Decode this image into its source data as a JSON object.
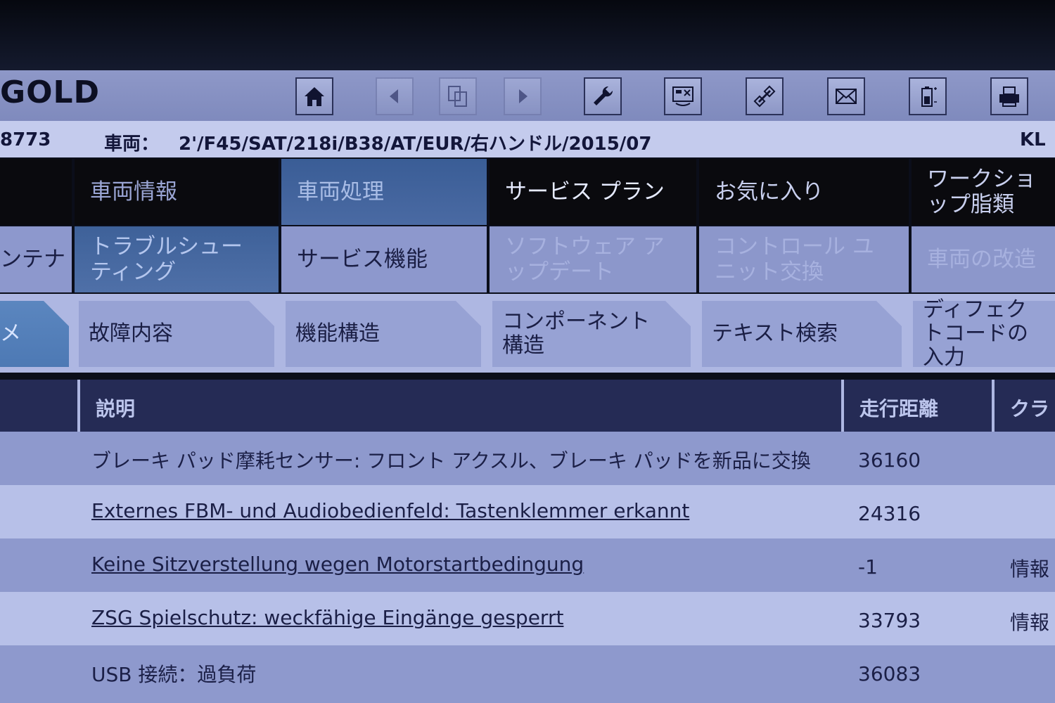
{
  "app_title": "GOLD",
  "toolbar": {
    "buttons": [
      {
        "icon": "home-icon",
        "enabled": true
      },
      {
        "icon": "arrow-left-icon",
        "enabled": false
      },
      {
        "icon": "documents-icon",
        "enabled": false
      },
      {
        "icon": "arrow-right-icon",
        "enabled": false
      },
      {
        "icon": "wrench-icon",
        "enabled": true
      },
      {
        "icon": "vehicle-test-icon",
        "enabled": true
      },
      {
        "icon": "connection-icon",
        "enabled": true
      },
      {
        "icon": "mail-icon",
        "enabled": true
      },
      {
        "icon": "battery-icon",
        "enabled": true
      },
      {
        "icon": "printer-icon",
        "enabled": true
      }
    ]
  },
  "vehicle_bar": {
    "order_partial": "8773",
    "vehicle_label": "車両：",
    "vehicle_value": "2'/F45/SAT/218i/B38/AT/EUR/右ハンドル/2015/07",
    "kl_label": "KL"
  },
  "main_tabs": [
    {
      "label": "",
      "state": "inactive"
    },
    {
      "label": "車両情報",
      "state": "inactive"
    },
    {
      "label": "車両処理",
      "state": "active"
    },
    {
      "label": "サービス プラン",
      "state": "inactive"
    },
    {
      "label": "お気に入り",
      "state": "inactive"
    },
    {
      "label": "ワークショップ脂類",
      "state": "inactive"
    }
  ],
  "sub_tabs": [
    {
      "label": "ンテナ",
      "state": "enabled"
    },
    {
      "label": "トラブルシューティング",
      "state": "active"
    },
    {
      "label": "サービス機能",
      "state": "enabled"
    },
    {
      "label": "ソフトウェア アップデート",
      "state": "disabled"
    },
    {
      "label": "コントロール ユニット交換",
      "state": "disabled"
    },
    {
      "label": "車両の改造",
      "state": "disabled"
    }
  ],
  "folder_tabs": [
    {
      "label": "メ",
      "state": "active"
    },
    {
      "label": "故障内容",
      "state": "enabled"
    },
    {
      "label": "機能構造",
      "state": "enabled"
    },
    {
      "label": "コンポーネント構造",
      "state": "enabled"
    },
    {
      "label": "テキスト検索",
      "state": "enabled"
    },
    {
      "label": "ディフェクトコードの入力",
      "state": "enabled"
    }
  ],
  "table": {
    "headers": {
      "description": "説明",
      "mileage": "走行距離",
      "class": "クラ"
    },
    "rows": [
      {
        "description": "ブレーキ パッド摩耗センサー: フロント アクスル、ブレーキ パッドを新品に交換",
        "mileage": "36160",
        "class": "",
        "link": false
      },
      {
        "description": "Externes FBM- und Audiobedienfeld: Tastenklemmer erkannt",
        "mileage": "24316",
        "class": "",
        "link": true
      },
      {
        "description": "Keine Sitzverstellung wegen Motorstartbedingung",
        "mileage": "-1",
        "class": "情報",
        "link": true
      },
      {
        "description": "ZSG Spielschutz: weckfähige Eingänge gesperrt",
        "mileage": "33793",
        "class": "情報",
        "link": true
      },
      {
        "description": "USB 接続：過負荷",
        "mileage": "36083",
        "class": "",
        "link": false
      }
    ]
  }
}
